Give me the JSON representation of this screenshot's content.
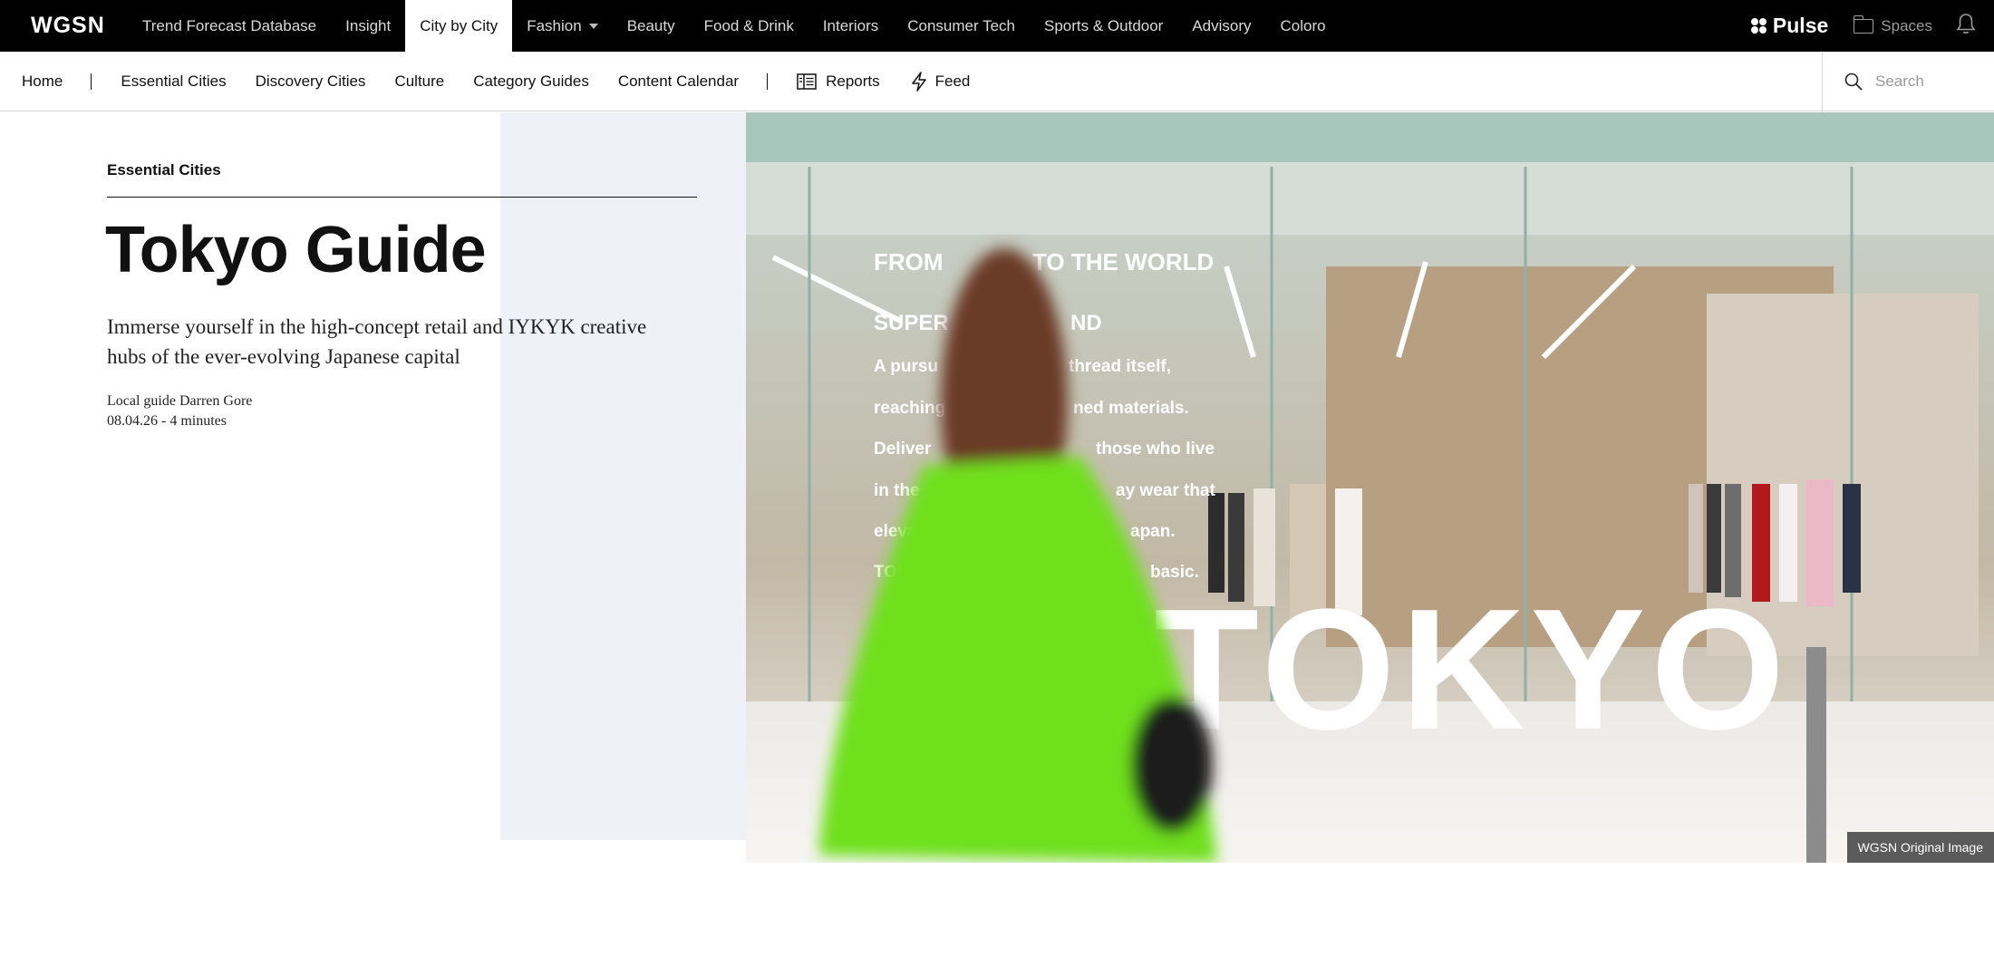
{
  "header": {
    "logo": "WGSN",
    "nav": [
      {
        "label": "Trend Forecast Database"
      },
      {
        "label": "Insight"
      },
      {
        "label": "City by City",
        "active": true
      },
      {
        "label": "Fashion",
        "dropdown": true
      },
      {
        "label": "Beauty"
      },
      {
        "label": "Food & Drink"
      },
      {
        "label": "Interiors"
      },
      {
        "label": "Consumer Tech"
      },
      {
        "label": "Sports & Outdoor"
      },
      {
        "label": "Advisory"
      },
      {
        "label": "Coloro"
      }
    ],
    "pulse_label": "Pulse",
    "spaces_label": "Spaces"
  },
  "subnav": {
    "home": "Home",
    "items": [
      "Essential Cities",
      "Discovery Cities",
      "Culture",
      "Category Guides",
      "Content Calendar"
    ],
    "reports": "Reports",
    "feed": "Feed",
    "search_placeholder": "Search"
  },
  "article": {
    "eyebrow": "Essential Cities",
    "title": "Tokyo Guide",
    "subtitle": "Immerse yourself in the high-concept retail and IYKYK creative hubs of the ever-evolving Japanese capital",
    "author_line": "Local guide Darren Gore",
    "date_line": "08.04.26 - 4 minutes"
  },
  "hero": {
    "sign_lines": [
      "FROM",
      "TO THE WORLD",
      "SUPER",
      "ND",
      "A pursu",
      "thread itself,",
      "reaching",
      "ned materials.",
      "Deliver",
      "those who live",
      "in the",
      "ay wear that",
      "elevat",
      "apan.",
      "TOKY",
      "basic."
    ],
    "big_word": "TOKYO",
    "caption": "WGSN Original Image"
  },
  "colors": {
    "topbar": "#000000",
    "panel": "#eef1f7",
    "accent_green": "#6fe01a"
  }
}
